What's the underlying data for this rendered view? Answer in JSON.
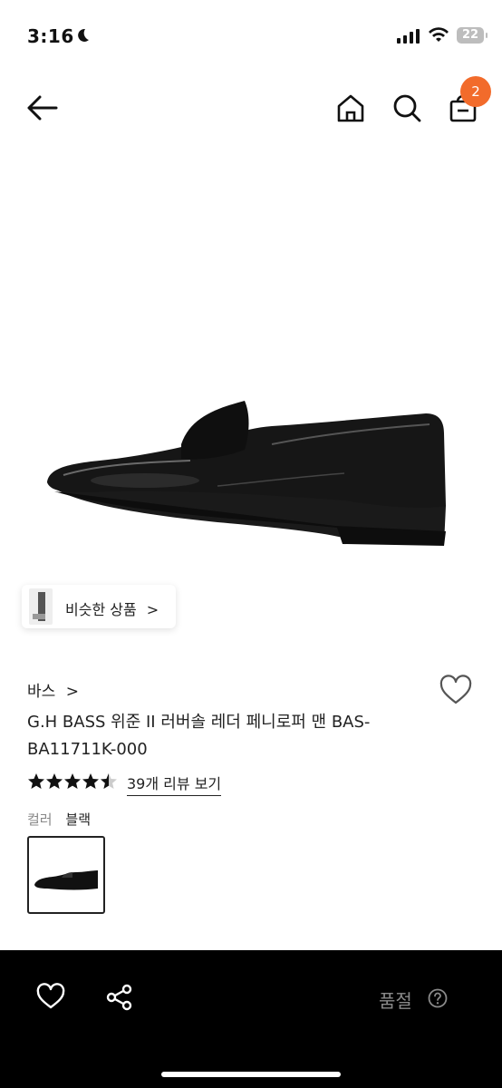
{
  "status_bar": {
    "time": "3:16",
    "battery": "22"
  },
  "header": {
    "cart_count": "2"
  },
  "product": {
    "similar_label": "비슷한 상품",
    "similar_chevron": ">",
    "brand": "바스",
    "brand_chevron": ">",
    "title": "G.H BASS 위준 II 러버솔 레더 페니로퍼 맨 BAS-BA11711K-000",
    "rating": 4.5,
    "review_link": "39개 리뷰 보기",
    "color_label": "컬러",
    "color_value": "블랙"
  },
  "bottom_bar": {
    "soldout_label": "품절"
  },
  "colors": {
    "badge": "#f26b2b",
    "bar": "#000000"
  },
  "icons": [
    "back-arrow-icon",
    "home-icon",
    "search-icon",
    "cart-icon",
    "heart-icon",
    "share-icon",
    "help-icon",
    "star-icon"
  ]
}
